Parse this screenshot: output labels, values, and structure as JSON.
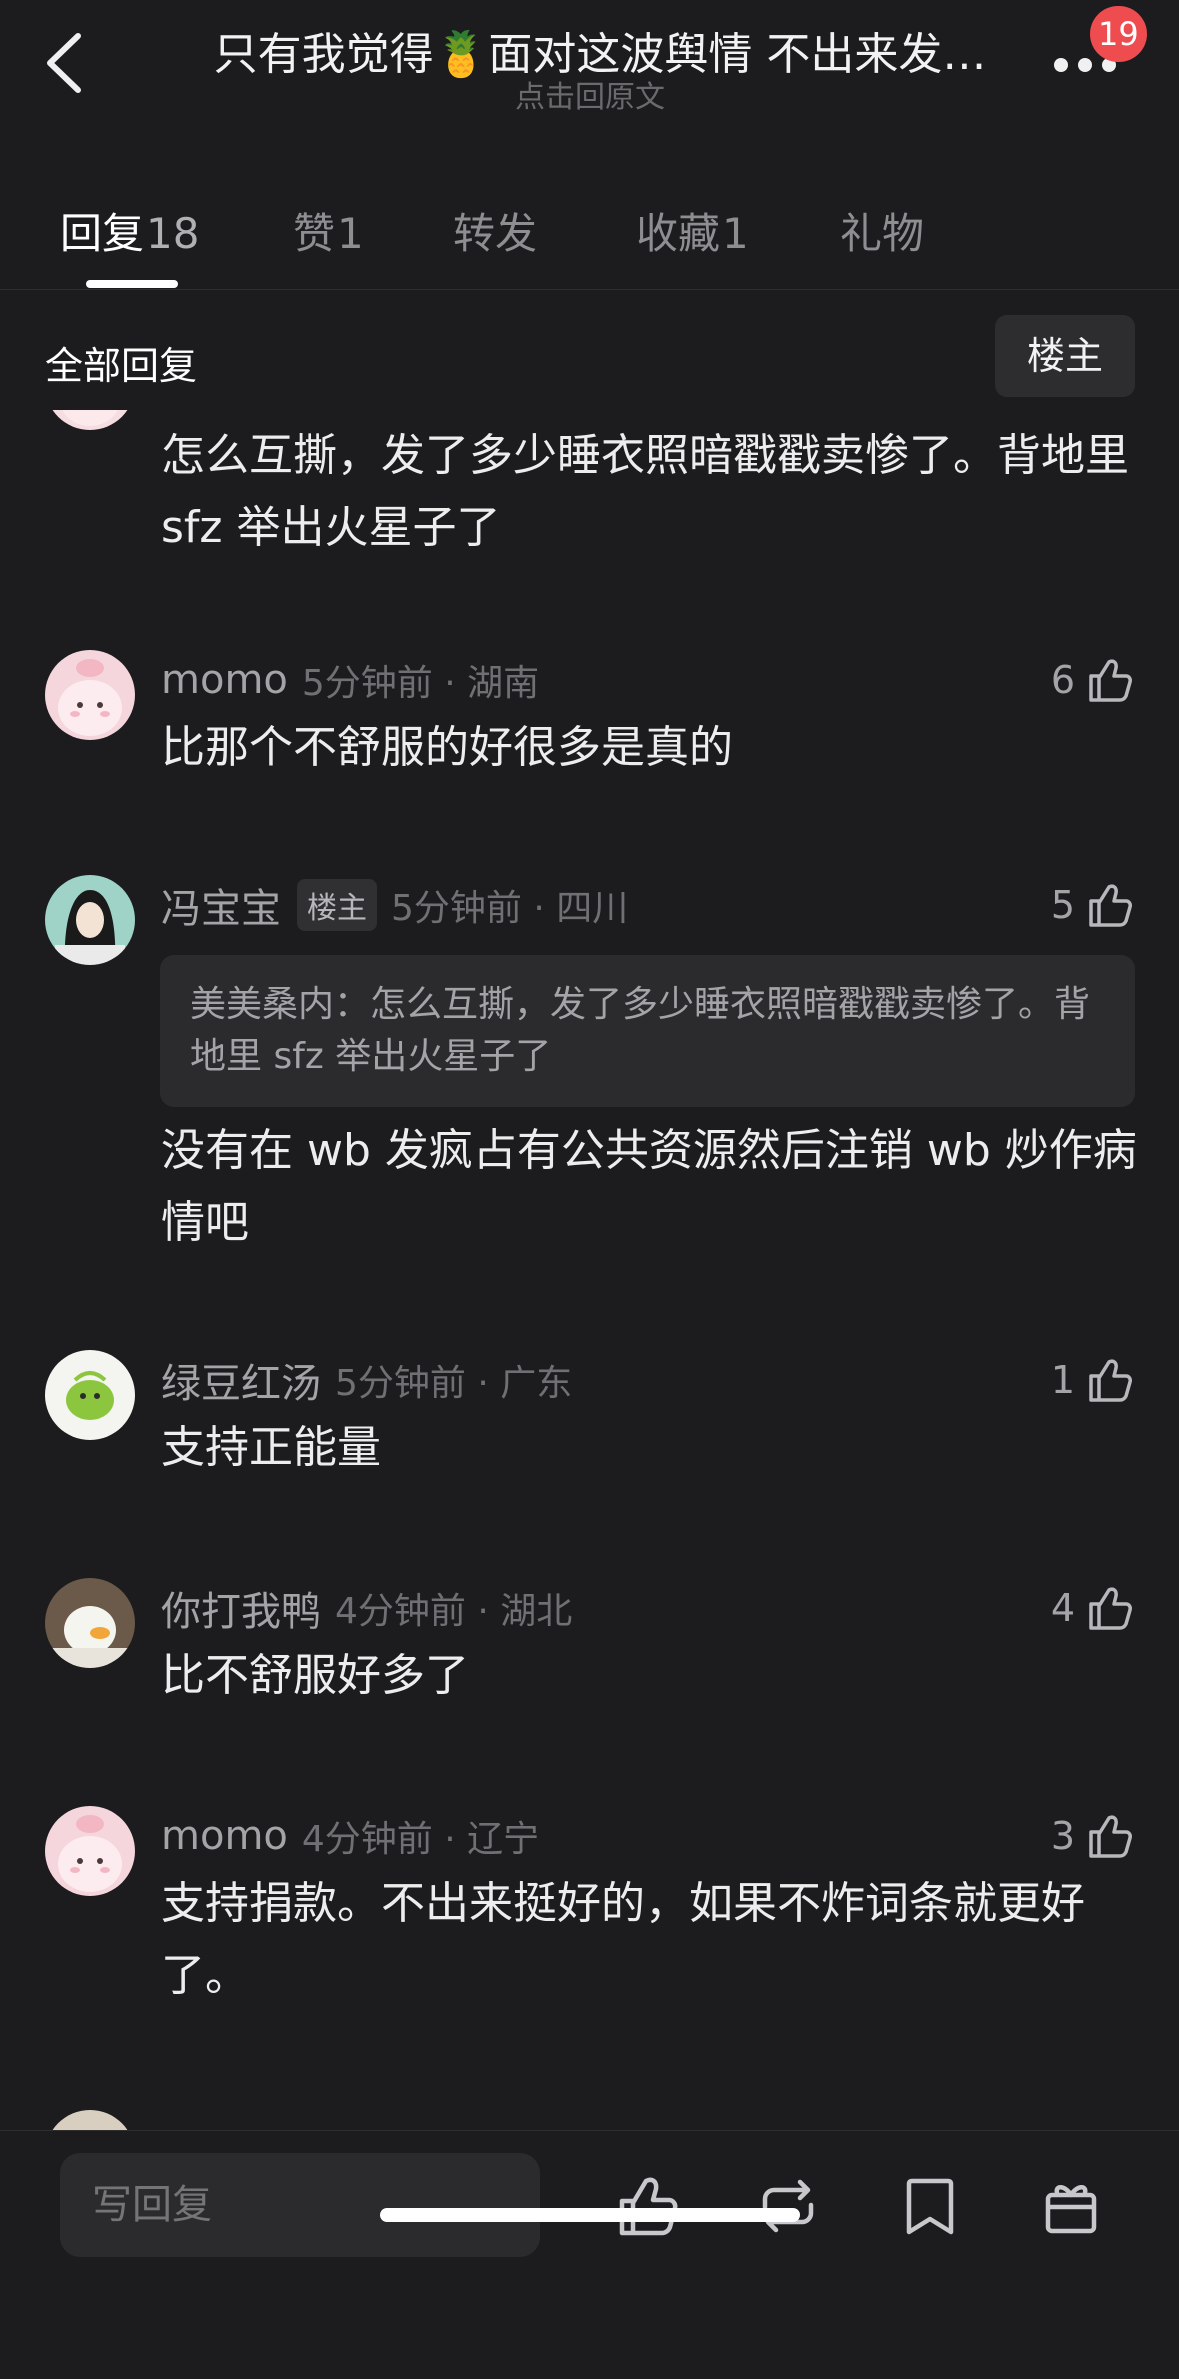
{
  "header": {
    "title": "只有我觉得🍍面对这波舆情  不出来发…",
    "subtitle": "点击回原文",
    "badge": "19",
    "back_icon": "chevron-left-icon",
    "more_icon": "more-dots-icon"
  },
  "tabs": [
    {
      "label": "回复",
      "count": "18"
    },
    {
      "label": "赞",
      "count": "1"
    },
    {
      "label": "转发",
      "count": ""
    },
    {
      "label": "收藏",
      "count": "1"
    },
    {
      "label": "礼物",
      "count": ""
    }
  ],
  "filter": {
    "title": "全部回复",
    "owner_button": "楼主"
  },
  "comments": [
    {
      "text": "怎么互撕，发了多少睡衣照暗戳戳卖惨了。背地里 sfz 举出火星子了"
    },
    {
      "name": "momo",
      "time": "5分钟前 · 湖南",
      "likes": "6",
      "text": "比那个不舒服的好很多是真的"
    },
    {
      "name": "冯宝宝",
      "owner_tag": "楼主",
      "time": "5分钟前 · 四川",
      "likes": "5",
      "quote": "美美桑内：怎么互撕，发了多少睡衣照暗戳戳卖惨了。背地里 sfz 举出火星子了",
      "text": "没有在 wb 发疯占有公共资源然后注销 wb 炒作病情吧"
    },
    {
      "name": "绿豆红汤",
      "time": "5分钟前 · 广东",
      "likes": "1",
      "text": "支持正能量"
    },
    {
      "name": "你打我鸭",
      "time": "4分钟前 · 湖北",
      "likes": "4",
      "text": "比不舒服好多了"
    },
    {
      "name": "momo",
      "time": "4分钟前 · 辽宁",
      "likes": "3",
      "text": "支持捐款。不出来挺好的，如果不炸词条就更好了。"
    }
  ],
  "bottom_bar": {
    "reply_placeholder": "写回复",
    "icons": [
      "thumbs-up-icon",
      "repost-icon",
      "bookmark-icon",
      "gift-icon"
    ]
  },
  "colors": {
    "background": "#1c1c1e",
    "badge": "#ee4c4f",
    "quote_bg": "#2b2b2e"
  }
}
